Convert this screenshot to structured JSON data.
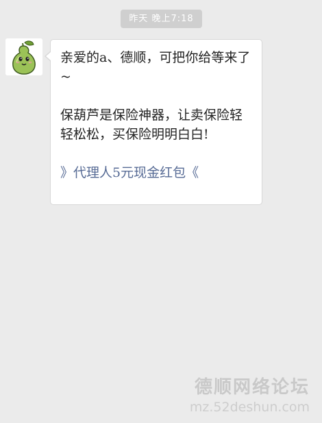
{
  "chat": {
    "timestamp": "昨天 晚上7:18",
    "message": {
      "line1": "亲爱的a、德顺，可把你给等来了~",
      "line2": "保葫芦是保险神器，让卖保险轻轻松松，买保险明明白白!",
      "link_text": "》代理人5元现金红包《"
    },
    "avatar_icon": "gourd-mascot-icon"
  },
  "watermark": {
    "title": "德顺网络论坛",
    "url": "mz.52deshun.com"
  },
  "colors": {
    "background": "#ebebeb",
    "bubble": "#ffffff",
    "link": "#576b95",
    "timestamp_bg": "#cfcfcf",
    "avatar_gourd": "#9bc257"
  }
}
